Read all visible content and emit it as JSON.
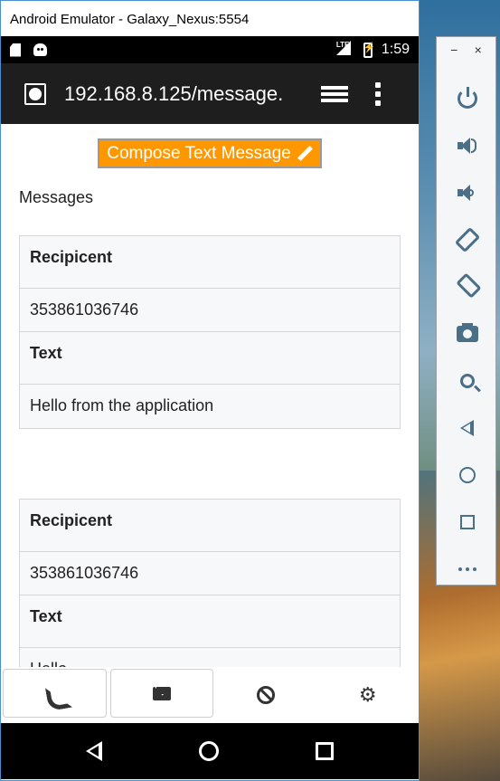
{
  "window": {
    "title": "Android Emulator - Galaxy_Nexus:5554"
  },
  "status_bar": {
    "network": "LTE",
    "time": "1:59"
  },
  "browser": {
    "url": "192.168.8.125/message."
  },
  "page": {
    "compose_button": "Compose Text Message",
    "heading": "Messages",
    "messages": [
      {
        "recipient_label": "Recipicent",
        "recipient": "353861036746",
        "text_label": "Text",
        "text": "Hello from the application"
      },
      {
        "recipient_label": "Recipicent",
        "recipient": "353861036746",
        "text_label": "Text",
        "text": "Hello"
      }
    ]
  },
  "bottom_nav": [
    {
      "icon": "phone-icon"
    },
    {
      "icon": "envelope-icon"
    },
    {
      "icon": "ban-icon"
    },
    {
      "icon": "gear-icon"
    }
  ],
  "side_panel": {
    "top": {
      "minimize": "−",
      "close": "×"
    },
    "buttons": [
      "power-icon",
      "volume-up-icon",
      "volume-down-icon",
      "rotate-left-icon",
      "rotate-right-icon",
      "camera-icon",
      "zoom-icon",
      "back-icon",
      "home-icon",
      "overview-icon",
      "more-icon"
    ]
  },
  "colors": {
    "compose_button_bg": "#ff9800",
    "status_bar_bg": "#000000",
    "url_bar_bg": "#1e1e1e",
    "table_bg": "#f7f8fa",
    "side_icon": "#4a6f87"
  }
}
